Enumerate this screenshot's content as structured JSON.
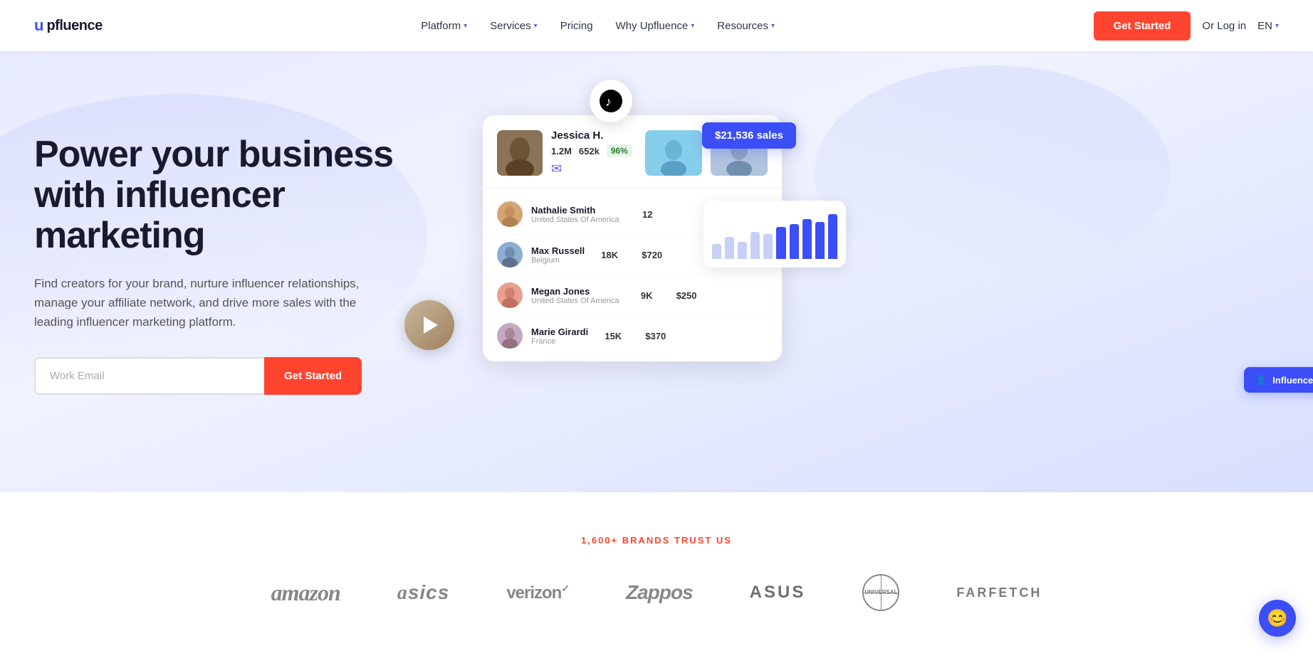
{
  "nav": {
    "logo_icon": "↑",
    "logo_text": "pfluence",
    "links": [
      {
        "label": "Platform",
        "has_chevron": true
      },
      {
        "label": "Services",
        "has_chevron": true
      },
      {
        "label": "Pricing",
        "has_chevron": false
      },
      {
        "label": "Why Upfluence",
        "has_chevron": true
      },
      {
        "label": "Resources",
        "has_chevron": true
      }
    ],
    "cta_label": "Get Started",
    "login_label": "Or Log in",
    "lang_label": "EN"
  },
  "hero": {
    "heading": "Power your business with influencer marketing",
    "subheading": "Find creators for your brand, nurture influencer relationships, manage your affiliate network, and drive more sales with the leading influencer marketing platform.",
    "email_placeholder": "Work Email",
    "cta_label": "Get Started"
  },
  "dashboard": {
    "featured_influencer": {
      "name": "Jessica H.",
      "followers": "1.2M",
      "engagement": "652k",
      "score": "96%"
    },
    "sales_badge": "$21,536 sales",
    "list": [
      {
        "name": "Nathalie Smith",
        "location": "United States Of America",
        "metric": "12",
        "sales": ""
      },
      {
        "name": "Max Russell",
        "location": "Belgium",
        "metric": "18K",
        "sales": "$720"
      },
      {
        "name": "Megan Jones",
        "location": "United States Of America",
        "metric": "9K",
        "sales": "$250"
      },
      {
        "name": "Marie Girardi",
        "location": "France",
        "metric": "15K",
        "sales": "$370"
      }
    ],
    "chart_bars": [
      30,
      45,
      35,
      55,
      50,
      65,
      70,
      80,
      75,
      90
    ],
    "matching_label": "Influencer Matching",
    "tiktok_icon": "♪",
    "instagram_icon": "◉",
    "twitch_icon": "▶"
  },
  "brands": {
    "label": "1,600+ BRANDS TRUST US",
    "logos": [
      {
        "name": "Amazon",
        "class": "brand-amazon"
      },
      {
        "name": "asics",
        "class": "brand-asics"
      },
      {
        "name": "verizon✓",
        "class": "brand-verizon"
      },
      {
        "name": "Zappos",
        "class": "brand-zappos"
      },
      {
        "name": "ASUS",
        "class": "brand-asus"
      },
      {
        "name": "UNIVERSAL",
        "class": "brand-universal"
      },
      {
        "name": "FARFETCH",
        "class": "brand-farfetch"
      }
    ]
  },
  "chat": {
    "icon": "😊"
  }
}
